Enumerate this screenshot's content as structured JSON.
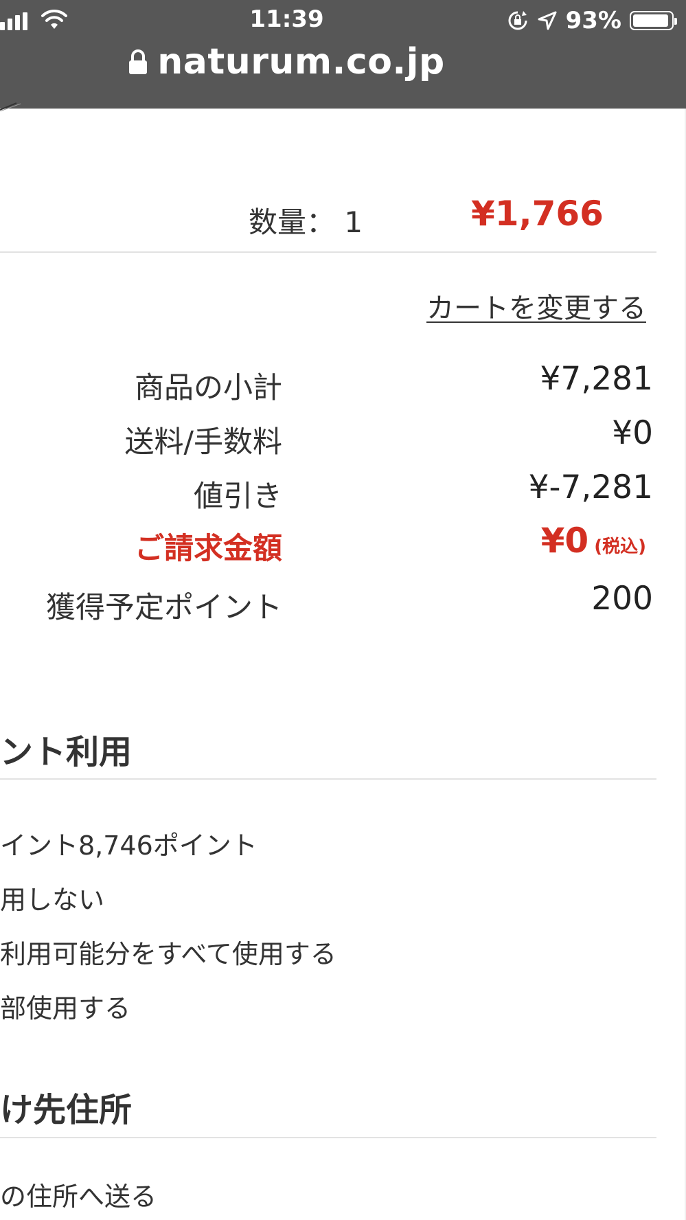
{
  "status_bar": {
    "time": "11:39",
    "battery_percent": "93%",
    "icons": [
      "signal-icon",
      "wifi-icon",
      "rotation-lock-icon",
      "location-arrow-icon",
      "battery-icon"
    ]
  },
  "browser": {
    "url": "naturum.co.jp"
  },
  "item": {
    "quantity_label": "数量： 1",
    "price": "¥1,766"
  },
  "cart": {
    "change_link": "カートを変更する"
  },
  "summary": {
    "subtotal_label": "商品の小計",
    "subtotal_value": "¥7,281",
    "shipping_label": "送料/手数料",
    "shipping_value": "¥0",
    "discount_label": "値引き",
    "discount_value": "¥-7,281",
    "total_label": "ご請求金額",
    "total_value": "¥0",
    "total_tax_note": "(税込)",
    "points_label": "獲得予定ポイント",
    "points_value": "200"
  },
  "points_section": {
    "title": "ント利用",
    "options": [
      "イント8,746ポイント",
      "用しない",
      "利用可能分をすべて使用する",
      "部使用する"
    ]
  },
  "address_section": {
    "title": "け先住所",
    "options": [
      "の住所へ送る"
    ]
  },
  "colors": {
    "accent_red": "#d32f22",
    "topbar_bg": "#575757"
  }
}
